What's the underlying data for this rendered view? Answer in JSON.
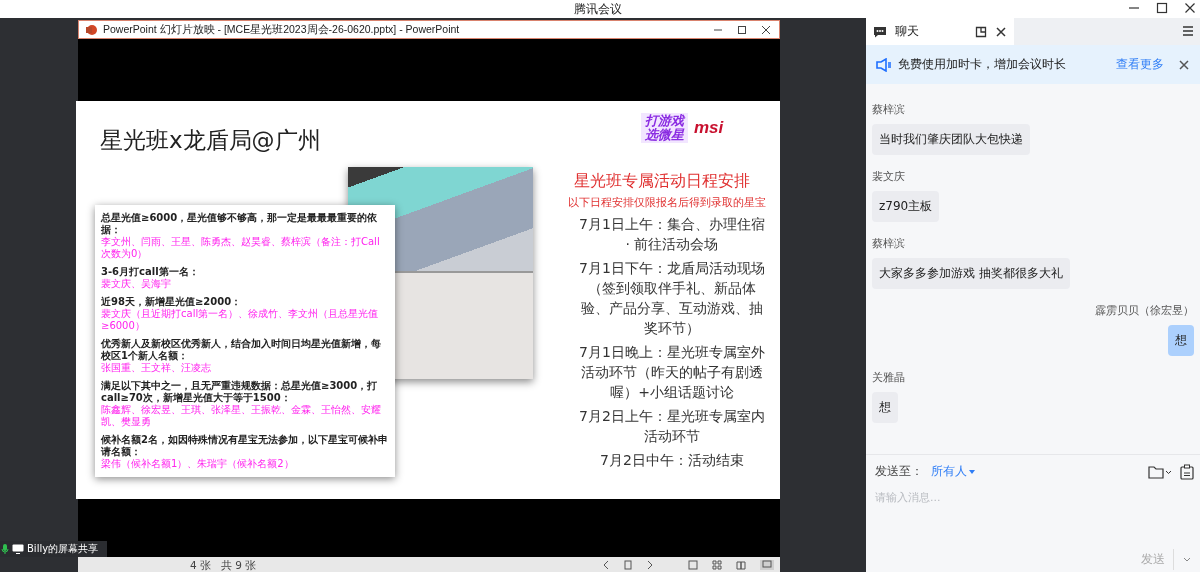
{
  "app_title": "腾讯会议",
  "presentation": {
    "window_title": "PowerPoint 幻灯片放映 - [MCE星光班2023周会-26-0620.pptx] - PowerPoint",
    "slide": {
      "title": "星光班x龙盾局@广州",
      "logo": {
        "lines": [
          "打游戏",
          "选微星"
        ],
        "brand": "msi"
      },
      "card": [
        {
          "kind": "heading",
          "text": "总星光值≥6000，星光值够不够高，那一定是最最最重要的依据："
        },
        {
          "kind": "names",
          "text": "李文州、闫雨、王星、陈勇杰、赵昊睿、蔡梓滨（备注：打Call次数为0）"
        },
        {
          "kind": "heading",
          "text": "3-6月打call第一名："
        },
        {
          "kind": "names",
          "text": "裴文庆、吴海宇"
        },
        {
          "kind": "heading",
          "text": "近98天，新增星光值≥2000："
        },
        {
          "kind": "names",
          "text": "裴文庆（且近期打call第一名）、徐成竹、李文州（且总星光值≥6000）"
        },
        {
          "kind": "heading",
          "text": "优秀新人及新校区优秀新人，结合加入时间日均星光值新增，每校区1个新人名额："
        },
        {
          "kind": "names",
          "text": "张国重、王文祥、汪凌志"
        },
        {
          "kind": "heading",
          "text": "满足以下其中之一，且无严重违规数据：总星光值≥3000，打call≥70次，新增星光值大于等于1500："
        },
        {
          "kind": "names",
          "text": "陈鑫辉、徐宏昱、王琪、张泽星、王振乾、金霖、王怡然、安耀凯、樊显勇"
        },
        {
          "kind": "heading",
          "text": "候补名额2名，如因特殊情况有星宝无法参加，以下星宝可候补申请名额："
        },
        {
          "kind": "names",
          "text": "梁伟（候补名额1）、朱瑞宇（候补名额2）"
        }
      ],
      "schedule": {
        "heading": "星光班专属活动日程安排",
        "subtitle": "以下日程安排仅限报名后得到录取的星宝",
        "items": [
          "7月1日上午：集合、办理住宿 · 前往活动会场",
          "7月1日下午：龙盾局活动现场（签到领取伴手礼、新品体验、产品分享、互动游戏、抽奖环节）",
          "7月1日晚上：星光班专属室外活动环节（昨天的帖子有剧透喔）+小组话题讨论",
          "7月2日上午：星光班专属室内活动环节",
          "7月2日中午：活动结束"
        ]
      }
    },
    "status": [
      "4 张",
      "共 9 张"
    ]
  },
  "share_label": "Billy的屏幕共享",
  "chat": {
    "tab": "聊天",
    "banner": {
      "text": "免费使用加时卡，增加会议时长",
      "link": "查看更多"
    },
    "messages": [
      {
        "kind": "incoming",
        "sender": "蔡梓滨",
        "text": "当时我们肇庆团队大包快递"
      },
      {
        "kind": "incoming",
        "sender": "裴文庆",
        "text": "z790主板"
      },
      {
        "kind": "incoming",
        "sender": "蔡梓滨",
        "text": "大家多多参加游戏 抽奖都很多大礼"
      },
      {
        "kind": "outgoing",
        "sender": "霹雳贝贝（徐宏昱）",
        "text": "想"
      },
      {
        "kind": "incoming",
        "sender": "关雅晶",
        "text": "想"
      }
    ],
    "send_to_label": "发送至：",
    "recipient": "所有人",
    "input": {
      "placeholder": "请输入消息..."
    },
    "send_button": {
      "label": "发送",
      "disabled": true
    }
  }
}
